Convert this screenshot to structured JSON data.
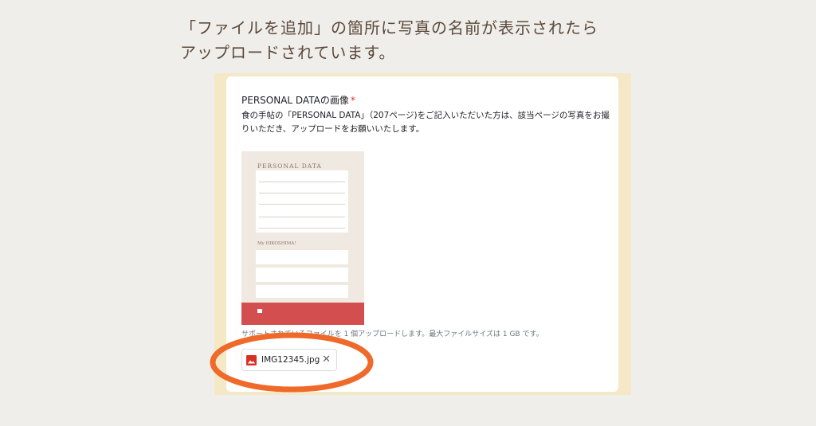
{
  "heading": {
    "line1": "「ファイルを追加」の箇所に写真の名前が表示されたら",
    "line2": "アップロードされています。"
  },
  "form": {
    "question_title": "PERSONAL DATAの画像",
    "required_mark": "*",
    "description": "食の手帖の「PERSONAL DATA」（207ページ)をご記入いただいた方は、該当ページの写真をお撮りいただき、アップロードをお願いいたします。",
    "sample_image": {
      "title": "PERSONAL DATA",
      "section": "My HIKOSHIMA!"
    },
    "support_text": "サポートされているファイルを 1 個アップロードします。最大ファイルサイズは 1 GB です。",
    "uploaded_file": {
      "name": "IMG12345.jpg",
      "icon": "image-file-icon",
      "remove_icon": "close-icon"
    }
  },
  "colors": {
    "heading_text": "#5b4a3c",
    "frame": "#f5e8c6",
    "required": "#d93025",
    "highlight_circle": "#ef6a2a",
    "image_icon": "#d93025"
  }
}
